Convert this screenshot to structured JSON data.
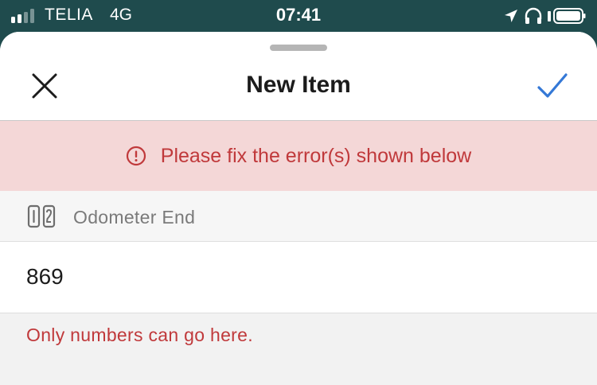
{
  "status_bar": {
    "carrier": "TELIA",
    "network": "4G",
    "time": "07:41",
    "icons": [
      "signal-icon",
      "location-arrow-icon",
      "headphones-icon",
      "battery-icon"
    ]
  },
  "header": {
    "title": "New Item",
    "close_icon": "close-icon",
    "done_icon": "checkmark-icon"
  },
  "error_banner": {
    "icon": "alert-circle-icon",
    "message": "Please fix the error(s) shown below"
  },
  "field": {
    "icon": "odometer-icon",
    "label": "Odometer End",
    "value": "869",
    "error": "Only numbers can go here."
  },
  "colors": {
    "status_bar_bg": "#1f4b4d",
    "accent_blue": "#3478d6",
    "error_red": "#c0393b",
    "error_bg": "#f4d7d7"
  }
}
